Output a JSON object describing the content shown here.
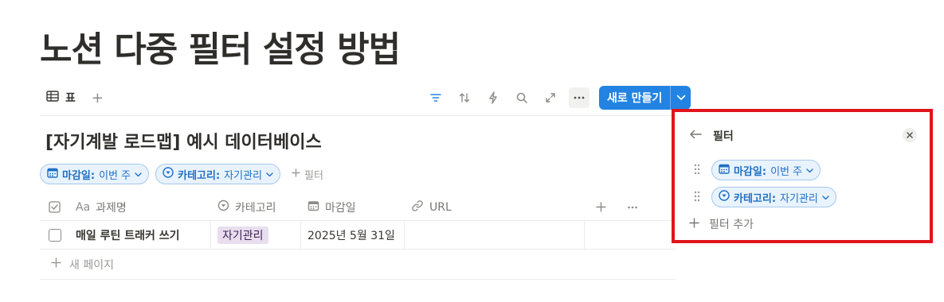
{
  "page": {
    "title": "노션 다중 필터 설정 방법"
  },
  "view": {
    "tab_label": "표"
  },
  "toolbar": {
    "new_button_label": "새로 만들기"
  },
  "database": {
    "title": "[자기계발 로드맵] 예시 데이터베이스"
  },
  "filters": [
    {
      "key": "마감일:",
      "value": "이번 주",
      "icon": "calendar-icon"
    },
    {
      "key": "카테고리:",
      "value": "자기관리",
      "icon": "select-icon"
    }
  ],
  "add_filter_label": "필터",
  "table": {
    "columns": [
      {
        "label": "과제명",
        "icon": "text-icon",
        "icon_text": "Aa"
      },
      {
        "label": "카테고리",
        "icon": "select-icon"
      },
      {
        "label": "마감일",
        "icon": "calendar-icon"
      },
      {
        "label": "URL",
        "icon": "link-icon"
      }
    ],
    "rows": [
      {
        "name": "매일 루틴 트래커 쓰기",
        "category": "자기관리",
        "due": "2025년 5월 31일",
        "url": ""
      }
    ],
    "new_page_label": "새 페이지"
  },
  "filter_panel": {
    "title": "필터",
    "add_label": "필터 추가"
  },
  "colors": {
    "accent": "#2383e2",
    "chip_bg": "#e9f3fd",
    "chip_text": "#1f6fc5",
    "tag_bg": "#e8deee",
    "highlight": "#e0141c"
  }
}
